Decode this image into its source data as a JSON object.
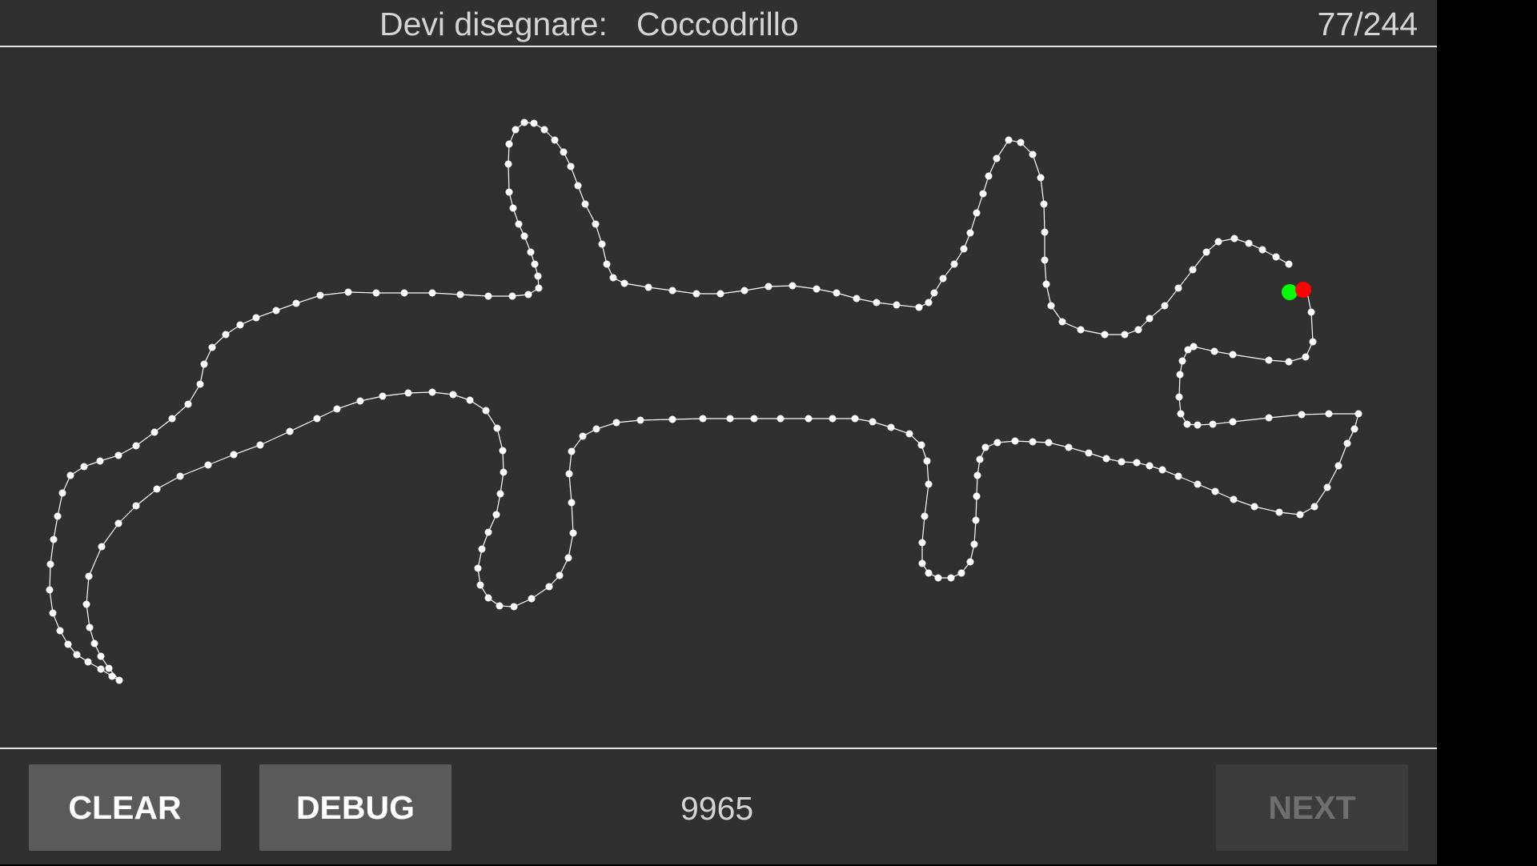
{
  "header": {
    "prompt_label": "Devi disegnare:",
    "prompt_word": "Coccodrillo",
    "progress": "77/244"
  },
  "footer": {
    "clear_label": "CLEAR",
    "debug_label": "DEBUG",
    "score": "9965",
    "next_label": "NEXT",
    "next_enabled": false
  },
  "drawing": {
    "stroke_color": "#ffffff",
    "point_color": "#ffffff",
    "start_marker_color": "#00ff00",
    "end_marker_color": "#ff0000"
  }
}
